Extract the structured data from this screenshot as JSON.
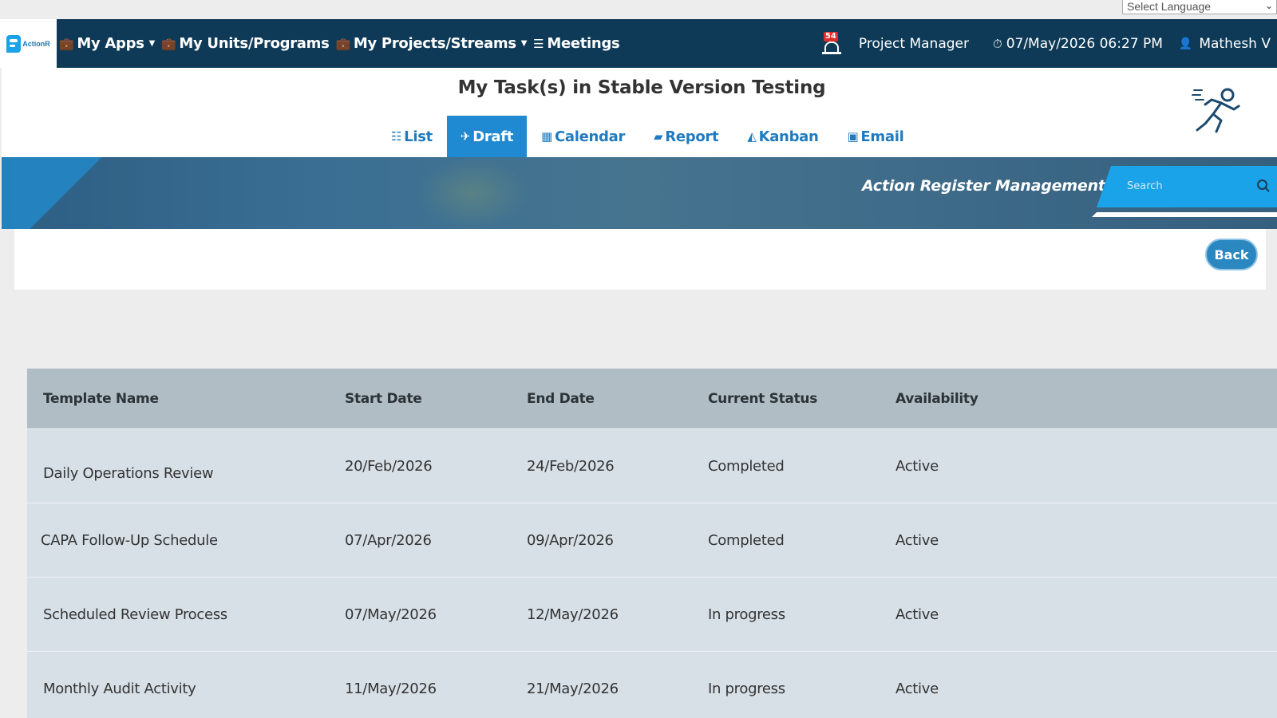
{
  "language_select": {
    "placeholder": "Select Language"
  },
  "logo": {
    "text": "ActionR"
  },
  "nav": {
    "my_apps": "My Apps",
    "my_units": "My Units/Programs",
    "my_projects": "My Projects/Streams",
    "meetings": "Meetings"
  },
  "header_right": {
    "notification_count": "54",
    "role": "Project Manager",
    "datetime": "07/May/2026 06:27 PM",
    "user": "Mathesh V"
  },
  "page_title": "My Task(s) in Stable Version Testing",
  "tabs": [
    {
      "label": "List",
      "icon": "list-icon",
      "active": false
    },
    {
      "label": "Draft",
      "icon": "paper-plane-icon",
      "active": true
    },
    {
      "label": "Calendar",
      "icon": "calendar-icon",
      "active": false
    },
    {
      "label": "Report",
      "icon": "book-icon",
      "active": false
    },
    {
      "label": "Kanban",
      "icon": "area-chart-icon",
      "active": false
    },
    {
      "label": "Email",
      "icon": "save-icon",
      "active": false
    }
  ],
  "banner": {
    "title": "Action Register Management",
    "search_placeholder": "Search"
  },
  "back_button": "Back",
  "table": {
    "headers": [
      "Template Name",
      "Start Date",
      "End Date",
      "Current Status",
      "Availability"
    ],
    "rows": [
      [
        "Daily Operations Review",
        "20/Feb/2026",
        "24/Feb/2026",
        "Completed",
        "Active"
      ],
      [
        "CAPA Follow-Up Schedule",
        "07/Apr/2026",
        "09/Apr/2026",
        "Completed",
        "Active"
      ],
      [
        "Scheduled Review Process",
        "07/May/2026",
        "12/May/2026",
        "In progress",
        "Active"
      ],
      [
        "Monthly Audit Activity",
        "11/May/2026",
        "21/May/2026",
        "In progress",
        "Active"
      ]
    ]
  },
  "colors": {
    "topbar": "#0e3a57",
    "accent": "#1f8ad1",
    "search": "#1aa3e8",
    "table_header": "#b0bdc5",
    "table_row": "#d8e0e7"
  }
}
